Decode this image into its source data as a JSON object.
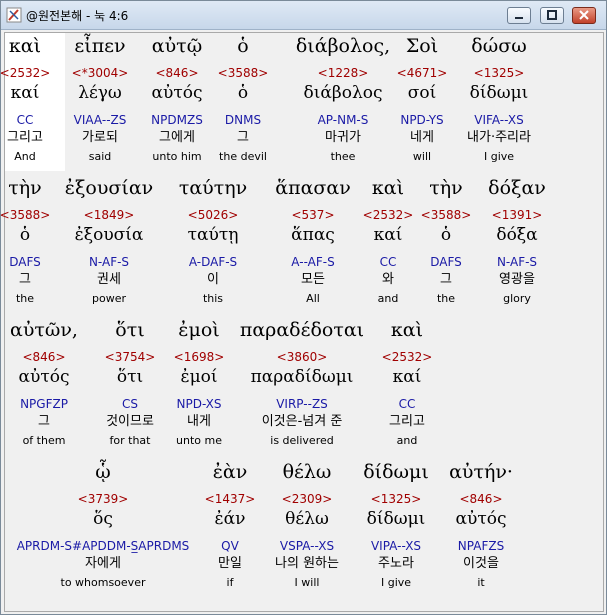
{
  "window": {
    "title": "@원전본해 - 눅 4:6"
  },
  "lines": [
    [
      {
        "greek": "καὶ",
        "strong": "<2532>",
        "lemma": "καί",
        "morph": "CC",
        "korean": "그리고",
        "english": "And"
      },
      {
        "greek": "εἶπεν",
        "strong": "<*3004>",
        "lemma": "λέγω",
        "morph": "VIAA--ZS",
        "korean": "가로되",
        "english": "said"
      },
      {
        "greek": "αὐτῷ",
        "strong": "<846>",
        "lemma": "αὐτός",
        "morph": "NPDMZS",
        "korean": "그에게",
        "english": "unto him"
      },
      {
        "greek": "ὁ",
        "strong": "<3588>",
        "lemma": "ὁ",
        "morph": "DNMS",
        "korean": "그",
        "english": "the devil"
      },
      {
        "greek": "διάβολος,",
        "strong": "<1228>",
        "lemma": "διάβολος",
        "morph": "AP-NM-S",
        "korean": "마귀가",
        "english": "thee"
      },
      {
        "greek": "Σοὶ",
        "strong": "<4671>",
        "lemma": "σοί",
        "morph": "NPD-YS",
        "korean": "네게",
        "english": "will"
      },
      {
        "greek": "δώσω",
        "strong": "<1325>",
        "lemma": "δίδωμι",
        "morph": "VIFA--XS",
        "korean": "내가·주리라",
        "english": "I give"
      }
    ],
    [
      {
        "greek": "τὴν",
        "strong": "<3588>",
        "lemma": "ὁ",
        "morph": "DAFS",
        "korean": "그",
        "english": "the"
      },
      {
        "greek": "ἐξουσίαν",
        "strong": "<1849>",
        "lemma": "ἐξουσία",
        "morph": "N-AF-S",
        "korean": "권세",
        "english": "power"
      },
      {
        "greek": "ταύτην",
        "strong": "<5026>",
        "lemma": "ταύτῃ",
        "morph": "A-DAF-S",
        "korean": "이",
        "english": "this"
      },
      {
        "greek": "ἅπασαν",
        "strong": "<537>",
        "lemma": "ἅπας",
        "morph": "A--AF-S",
        "korean": "모든",
        "english": "All"
      },
      {
        "greek": "καὶ",
        "strong": "<2532>",
        "lemma": "καί",
        "morph": "CC",
        "korean": "와",
        "english": "and"
      },
      {
        "greek": "τὴν",
        "strong": "<3588>",
        "lemma": "ὁ",
        "morph": "DAFS",
        "korean": "그",
        "english": "the"
      },
      {
        "greek": "δόξαν",
        "strong": "<1391>",
        "lemma": "δόξα",
        "morph": "N-AF-S",
        "korean": "영광을",
        "english": "glory"
      }
    ],
    [
      {
        "greek": "αὐτῶν,",
        "strong": "<846>",
        "lemma": "αὐτός",
        "morph": "NPGFZP",
        "korean": "그",
        "english": "of them"
      },
      {
        "greek": "ὅτι",
        "strong": "<3754>",
        "lemma": "ὅτι",
        "morph": "CS",
        "korean": "것이므로",
        "english": "for that"
      },
      {
        "greek": "ἐμοὶ",
        "strong": "<1698>",
        "lemma": "ἐμοί",
        "morph": "NPD-XS",
        "korean": "내게",
        "english": "unto me"
      },
      {
        "greek": "παραδέδοται",
        "strong": "<3860>",
        "lemma": "παραδίδωμι",
        "morph": "VIRP--ZS",
        "korean": "이것은-넘겨 준",
        "english": "is delivered"
      },
      {
        "greek": "καὶ",
        "strong": "<2532>",
        "lemma": "καί",
        "morph": "CC",
        "korean": "그리고",
        "english": "and"
      }
    ],
    [
      {
        "greek": "ᾧ",
        "strong": "<3739>",
        "lemma": "ὅς",
        "morph": "APRDM-S#APDDM-S̲APRDMS",
        "korean": "자에게",
        "english": "to whomsoever"
      },
      {
        "greek": "ἐὰν",
        "strong": "<1437>",
        "lemma": "ἐάν",
        "morph": "QV",
        "korean": "만일",
        "english": "if"
      },
      {
        "greek": "θέλω",
        "strong": "<2309>",
        "lemma": "θέλω",
        "morph": "VSPA--XS",
        "korean": "나의 원하는",
        "english": "I will"
      },
      {
        "greek": "δίδωμι",
        "strong": "<1325>",
        "lemma": "δίδωμι",
        "morph": "VIPA--XS",
        "korean": "주노라",
        "english": "I give"
      },
      {
        "greek": "αὐτήν·",
        "strong": "<846>",
        "lemma": "αὐτός",
        "morph": "NPAFZS",
        "korean": "이것을",
        "english": "it"
      }
    ]
  ]
}
